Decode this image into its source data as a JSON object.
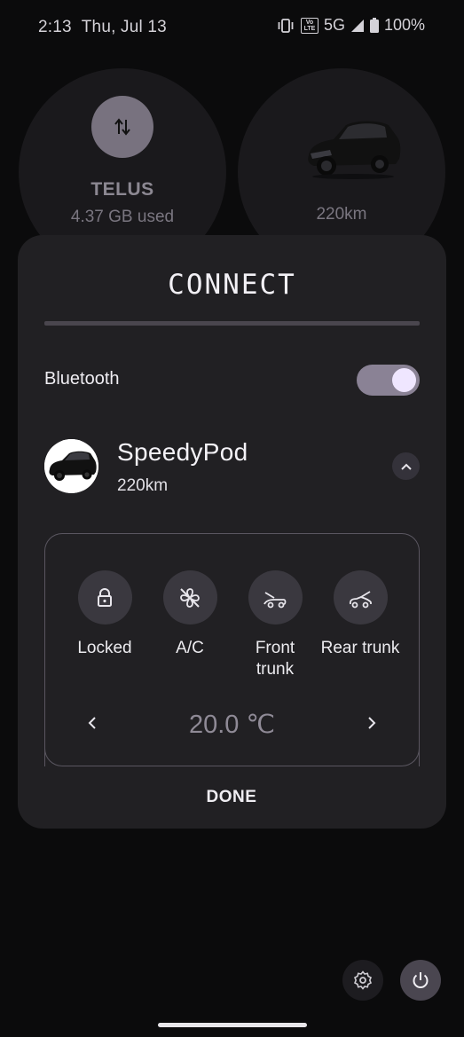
{
  "status_bar": {
    "time": "2:13",
    "date": "Thu, Jul 13",
    "vibrate_icon": "vibrate-icon",
    "volte_label": "Vo\nLTE",
    "network": "5G",
    "signal_icon": "signal-icon",
    "battery_icon": "battery-icon",
    "battery": "100%"
  },
  "tiles": {
    "telus": {
      "icon": "data-transfer-icon",
      "title": "TELUS",
      "subtitle": "4.37 GB used"
    },
    "car": {
      "icon": "car-image",
      "range": "220km"
    }
  },
  "dialog": {
    "title": "CONNECT",
    "bluetooth_label": "Bluetooth",
    "bluetooth_on": true,
    "device": {
      "name": "SpeedyPod",
      "range": "220km",
      "avatar": "car-image",
      "collapse_icon": "chevron-up-icon"
    },
    "controls": [
      {
        "label": "Locked",
        "icon": "lock-icon"
      },
      {
        "label": "A/C",
        "icon": "fan-off-icon"
      },
      {
        "label": "Front\ntrunk",
        "icon": "front-trunk-icon"
      },
      {
        "label": "Rear trunk",
        "icon": "rear-trunk-icon"
      }
    ],
    "temperature": "20.0 ℃",
    "done_label": "DONE"
  },
  "bottom": {
    "settings_icon": "gear-icon",
    "power_icon": "power-icon"
  },
  "colors": {
    "background": "#0b0b0c",
    "dialog": "#212023",
    "toggle_track": "#8a8295",
    "toggle_knob": "#efe6ff"
  }
}
